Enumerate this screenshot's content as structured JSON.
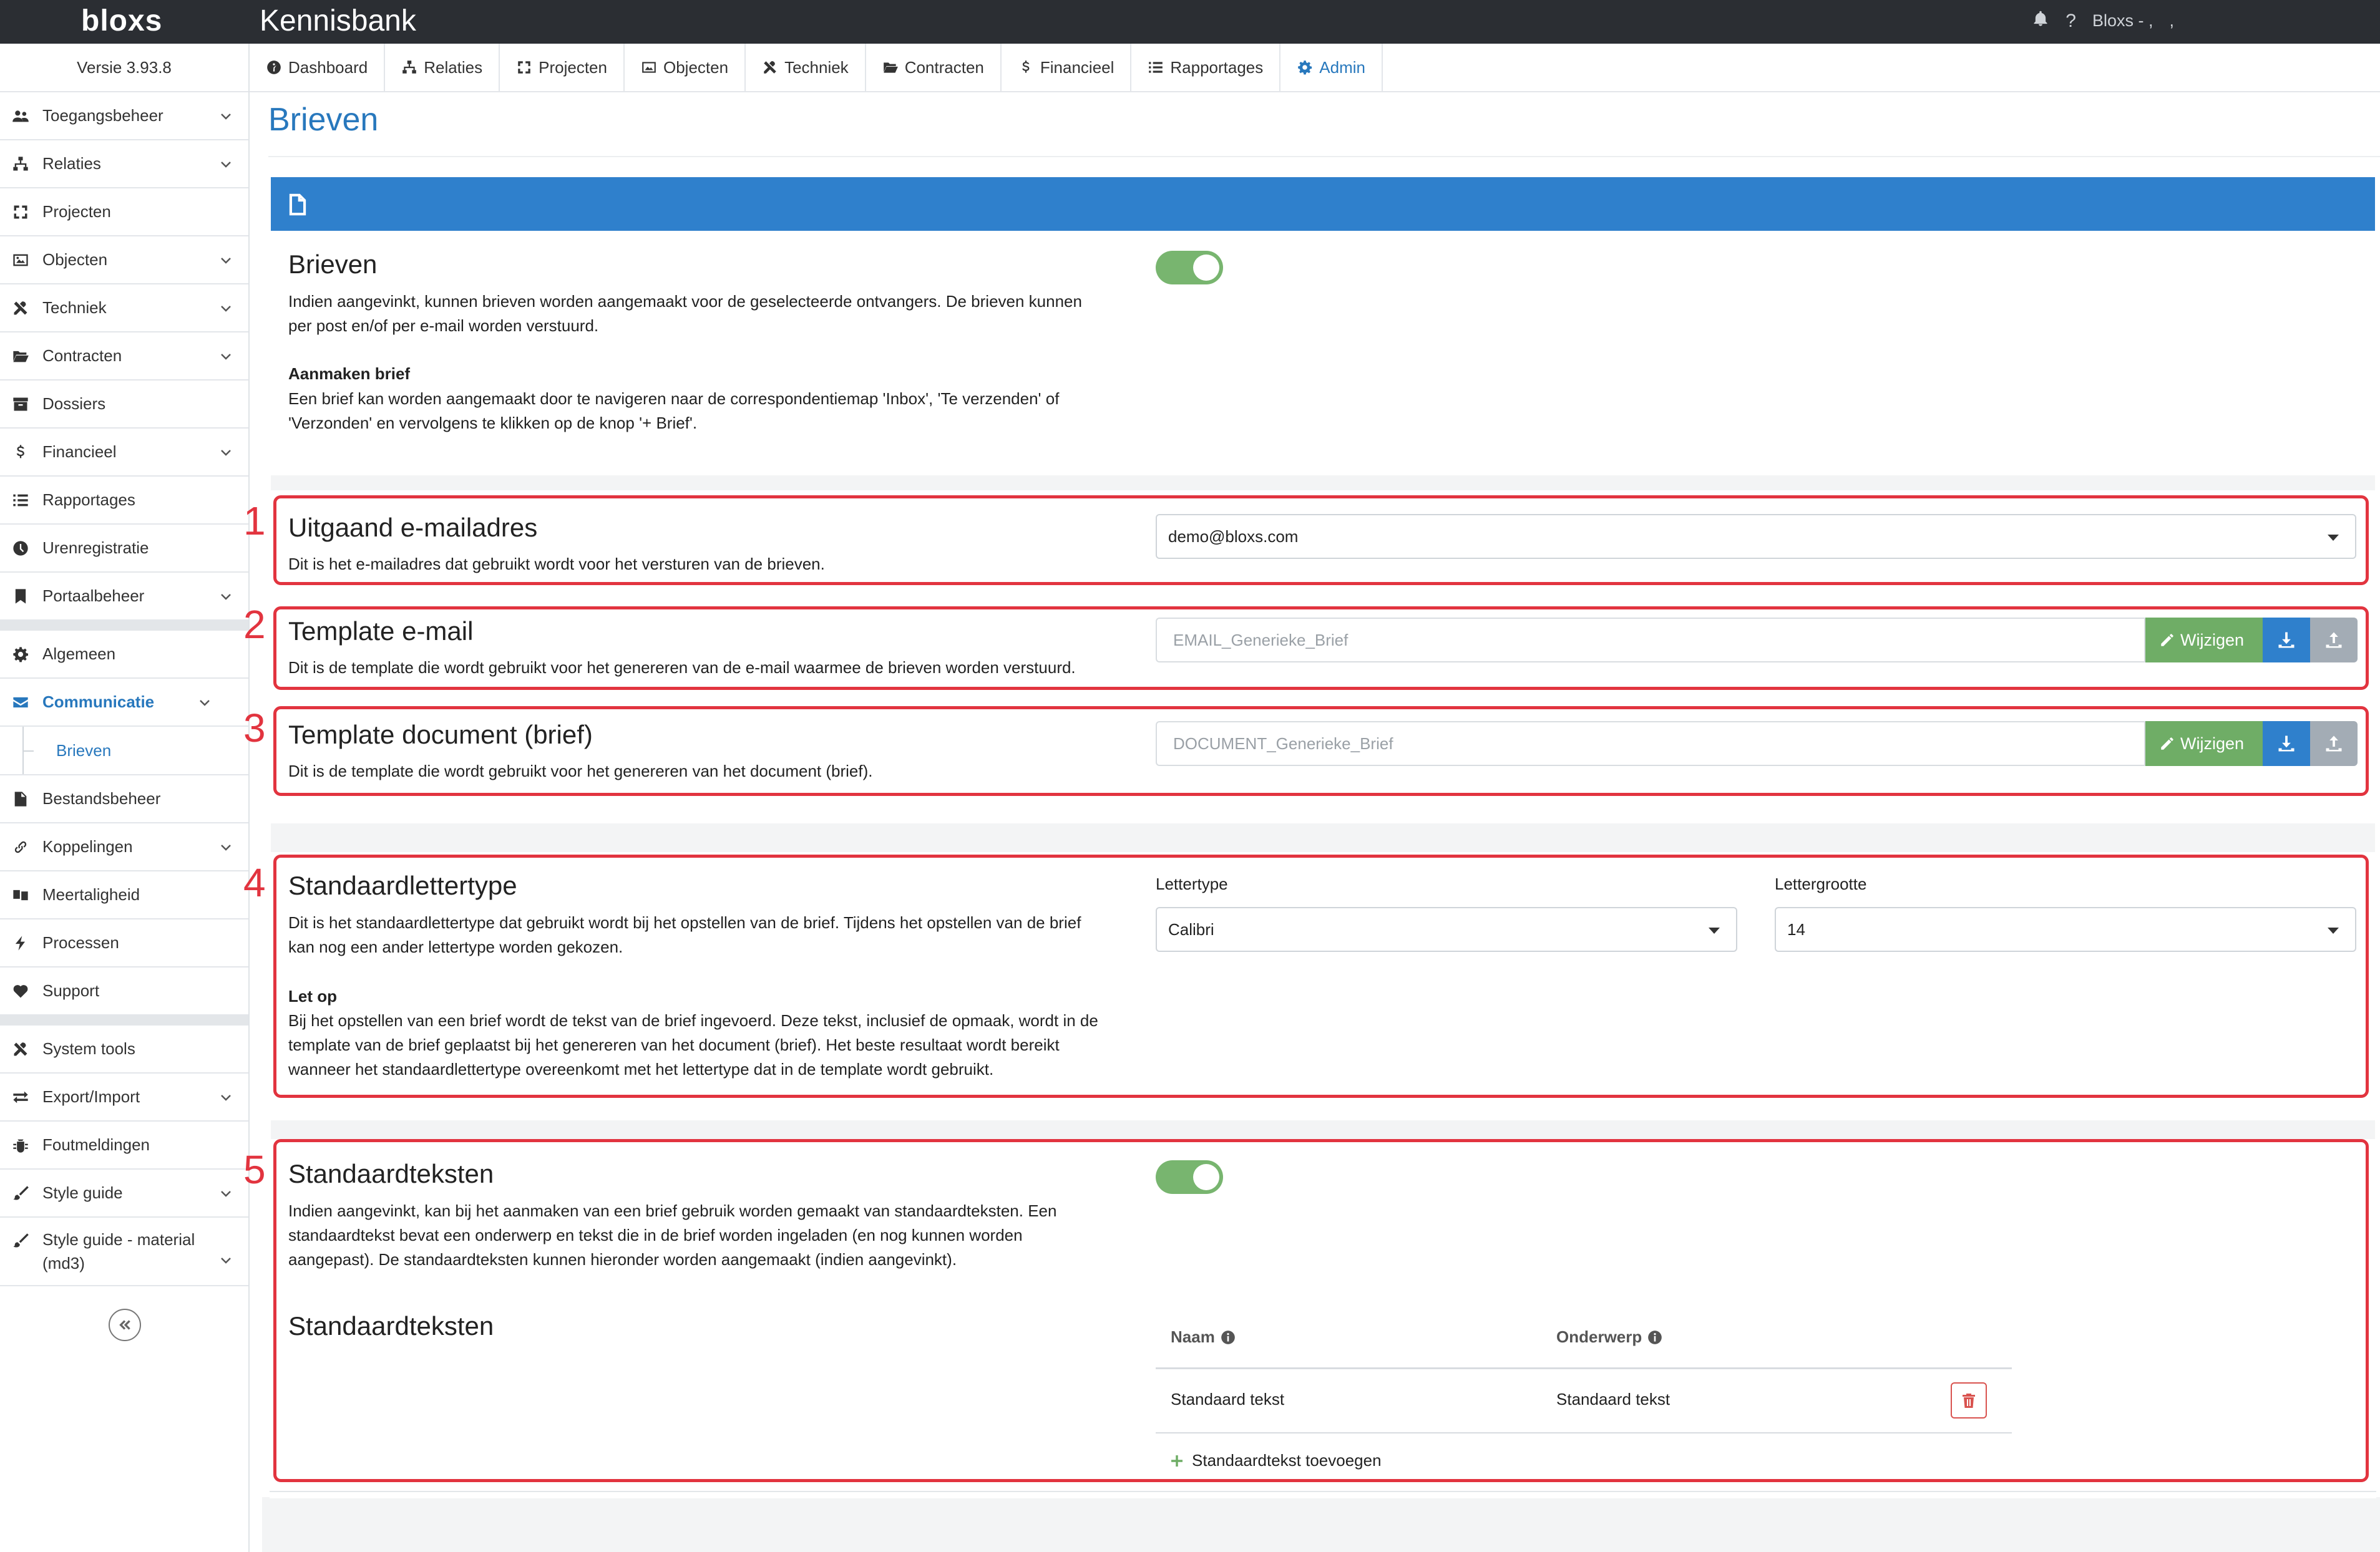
{
  "topbar": {
    "logo": "bloxs",
    "title": "Kennisbank",
    "user": "Bloxs - ,",
    "trailing": ","
  },
  "sidebar": {
    "version": "Versie 3.93.8",
    "items": [
      {
        "label": "Toegangsbeheer",
        "icon": "users-icon",
        "expandable": true
      },
      {
        "label": "Relaties",
        "icon": "sitemap-icon",
        "expandable": true
      },
      {
        "label": "Projecten",
        "icon": "expand-icon",
        "expandable": false
      },
      {
        "label": "Objecten",
        "icon": "image-icon",
        "expandable": true
      },
      {
        "label": "Techniek",
        "icon": "tools-icon",
        "expandable": true
      },
      {
        "label": "Contracten",
        "icon": "folder-open-icon",
        "expandable": true
      },
      {
        "label": "Dossiers",
        "icon": "archive-icon",
        "expandable": false
      },
      {
        "label": "Financieel",
        "icon": "dollar-icon",
        "expandable": true
      },
      {
        "label": "Rapportages",
        "icon": "list-icon",
        "expandable": false
      },
      {
        "label": "Urenregistratie",
        "icon": "clock-icon",
        "expandable": false
      },
      {
        "label": "Portaalbeheer",
        "icon": "bookmark-icon",
        "expandable": true
      }
    ],
    "items2": [
      {
        "label": "Algemeen",
        "icon": "gear-icon",
        "expandable": false
      },
      {
        "label": "Communicatie",
        "icon": "envelope-icon",
        "expandable": true,
        "active": true
      },
      {
        "label": "Brieven",
        "sub": true
      },
      {
        "label": "Bestandsbeheer",
        "icon": "file-icon",
        "expandable": false
      },
      {
        "label": "Koppelingen",
        "icon": "link-icon",
        "expandable": true
      },
      {
        "label": "Meertaligheid",
        "icon": "language-icon",
        "expandable": false
      },
      {
        "label": "Processen",
        "icon": "bolt-icon",
        "expandable": false
      },
      {
        "label": "Support",
        "icon": "heart-icon",
        "expandable": false
      }
    ],
    "items3": [
      {
        "label": "System tools",
        "icon": "tools-icon",
        "expandable": false
      },
      {
        "label": "Export/Import",
        "icon": "exchange-icon",
        "expandable": true
      },
      {
        "label": "Foutmeldingen",
        "icon": "bug-icon",
        "expandable": false
      },
      {
        "label": "Style guide",
        "icon": "brush-icon",
        "expandable": true
      },
      {
        "label": "Style guide - material (md3)",
        "icon": "brush-icon",
        "expandable": true
      }
    ]
  },
  "navtabs": [
    {
      "label": "Dashboard",
      "icon": "dashboard-icon"
    },
    {
      "label": "Relaties",
      "icon": "sitemap-icon"
    },
    {
      "label": "Projecten",
      "icon": "expand-icon"
    },
    {
      "label": "Objecten",
      "icon": "image-icon"
    },
    {
      "label": "Techniek",
      "icon": "tools-icon"
    },
    {
      "label": "Contracten",
      "icon": "folder-open-icon"
    },
    {
      "label": "Financieel",
      "icon": "dollar-icon"
    },
    {
      "label": "Rapportages",
      "icon": "list-icon"
    },
    {
      "label": "Admin",
      "icon": "gear-icon",
      "active": true
    }
  ],
  "page": {
    "title": "Brieven"
  },
  "brieven": {
    "title": "Brieven",
    "desc1": "Indien aangevinkt, kunnen brieven worden aangemaakt voor de geselecteerde ontvangers. De brieven kunnen",
    "desc2": "per post en/of per e-mail worden verstuurd.",
    "subtitle": "Aanmaken brief",
    "sub1": "Een brief kan worden aangemaakt door te navigeren naar de correspondentiemap 'Inbox', 'Te verzenden' of",
    "sub2": "'Verzonden' en vervolgens te klikken op de knop '+ Brief'.",
    "enabled": true
  },
  "markers": [
    "1",
    "2",
    "3",
    "4",
    "5"
  ],
  "email": {
    "title": "Uitgaand e-mailadres",
    "desc": "Dit is het e-mailadres dat gebruikt wordt voor het versturen van de brieven.",
    "value": "demo@bloxs.com"
  },
  "template_email": {
    "title": "Template e-mail",
    "desc": "Dit is de template die wordt gebruikt voor het genereren van de e-mail waarmee de brieven worden verstuurd.",
    "value": "EMAIL_Generieke_Brief",
    "button": "Wijzigen"
  },
  "template_doc": {
    "title": "Template document (brief)",
    "desc": "Dit is de template die wordt gebruikt voor het genereren van het document (brief).",
    "value": "DOCUMENT_Generieke_Brief",
    "button": "Wijzigen"
  },
  "font": {
    "title": "Standaardlettertype",
    "desc1": "Dit is het standaardlettertype dat gebruikt wordt bij het opstellen van de brief. Tijdens het opstellen van de brief",
    "desc2": "kan nog een ander lettertype worden gekozen.",
    "note_title": "Let op",
    "note1": "Bij het opstellen van een brief wordt de tekst van de brief ingevoerd. Deze tekst, inclusief de opmaak, wordt in de",
    "note2": "template van de brief geplaatst bij het genereren van het document (brief). Het beste resultaat wordt bereikt",
    "note3": "wanneer het standaardlettertype overeenkomt met het lettertype dat in de template wordt gebruikt.",
    "type_label": "Lettertype",
    "type_value": "Calibri",
    "size_label": "Lettergrootte",
    "size_value": "14"
  },
  "texts": {
    "title": "Standaardteksten",
    "desc1": "Indien aangevinkt, kan bij het aanmaken van een brief gebruik worden gemaakt van standaardteksten. Een",
    "desc2": "standaardtekst bevat een onderwerp en tekst die in de brief worden ingeladen (en nog kunnen worden",
    "desc3": "aangepast). De standaardteksten kunnen hieronder worden aangemaakt (indien aangevinkt).",
    "enabled": true,
    "list_title": "Standaardteksten",
    "col_name": "Naam",
    "col_subject": "Onderwerp",
    "rows": [
      {
        "name": "Standaard tekst",
        "subject": "Standaard tekst"
      }
    ],
    "add_label": "Standaardtekst toevoegen"
  }
}
